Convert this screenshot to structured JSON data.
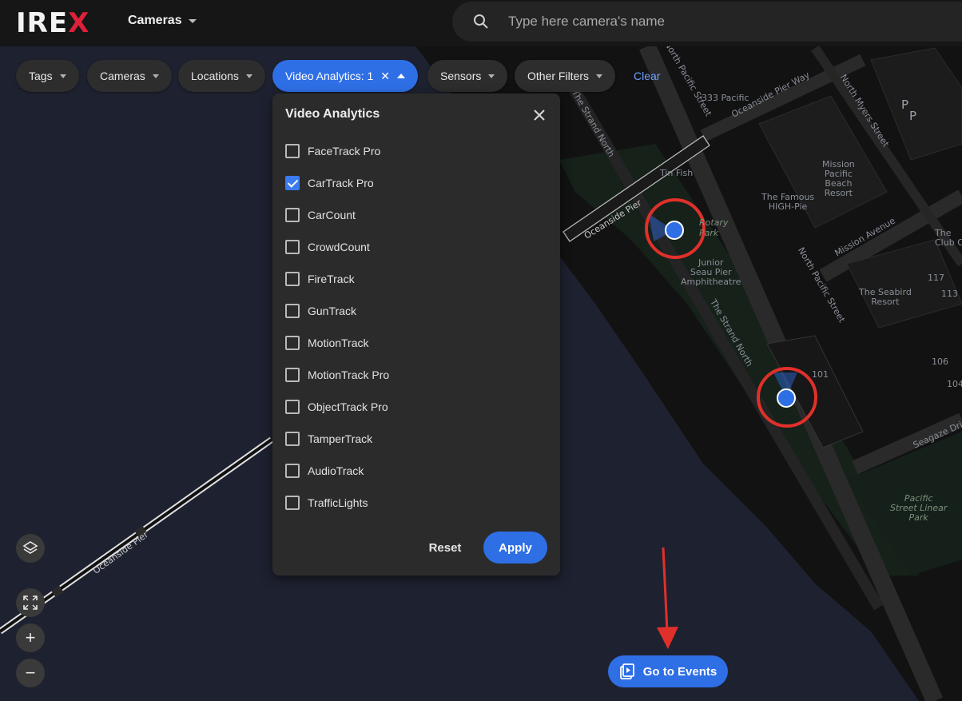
{
  "header": {
    "logo_text": "IRE",
    "logo_accent": "X",
    "menu_label": "Cameras",
    "search_placeholder": "Type here camera's name"
  },
  "filters": {
    "chips": [
      {
        "label": "Tags"
      },
      {
        "label": "Cameras"
      },
      {
        "label": "Locations"
      },
      {
        "label": "Video Analytics: 1",
        "active": true
      },
      {
        "label": "Sensors"
      },
      {
        "label": "Other Filters"
      }
    ],
    "clear_label": "Clear"
  },
  "dropdown": {
    "title": "Video Analytics",
    "options": [
      {
        "label": "FaceTrack Pro",
        "checked": false
      },
      {
        "label": "CarTrack Pro",
        "checked": true
      },
      {
        "label": "CarCount",
        "checked": false
      },
      {
        "label": "CrowdCount",
        "checked": false
      },
      {
        "label": "FireTrack",
        "checked": false
      },
      {
        "label": "GunTrack",
        "checked": false
      },
      {
        "label": "MotionTrack",
        "checked": false
      },
      {
        "label": "MotionTrack Pro",
        "checked": false
      },
      {
        "label": "ObjectTrack Pro",
        "checked": false
      },
      {
        "label": "TamperTrack",
        "checked": false
      },
      {
        "label": "AudioTrack",
        "checked": false
      },
      {
        "label": "TrafficLights",
        "checked": false
      }
    ],
    "reset_label": "Reset",
    "apply_label": "Apply"
  },
  "map": {
    "labels": {
      "pacific_st_top": "North Pacific Street",
      "strand_north_top": "The Strand North",
      "pacific_333": "333 Pacific",
      "oceanside_pier_way": "Oceanside Pier Way",
      "north_myers": "North Myers Street",
      "mission_pacific": "Mission\nPacific\nBeach\nResort",
      "tin_fish": "Tin Fish",
      "famous_high_pie": "The Famous\nHIGH-Pie",
      "oceanside_pier_a": "Oceanside Pier",
      "rotary_park": "Rotary\nPark",
      "junior_seau": "Junior\nSeau Pier\nAmphitheatre",
      "mission_avenue": "Mission Avenue",
      "the_club": "The\nClub O",
      "pacific_st_mid": "North Pacific Street",
      "n117": "117",
      "n113": "113",
      "seabird": "The Seabird\nResort",
      "strand_north_mid": "The Strand North",
      "n106": "106",
      "n101": "101",
      "n104": "104",
      "seagaze": "Seagaze Drive",
      "pacific_linear_park": "Pacific\nStreet Linear\nPark",
      "oceanside_pier_b": "Oceanside Pier",
      "parking": "P"
    }
  },
  "controls": {
    "zoom_in": "+",
    "zoom_out": "−",
    "events_label": "Go to Events"
  },
  "colors": {
    "accent": "#2f6fe6",
    "logo_accent": "#e0203a",
    "annotation": "#e0302a",
    "water": "#1e2230",
    "land": "#121212",
    "park": "#16211a",
    "road": "#262626",
    "camera": "#2f6fe6"
  }
}
